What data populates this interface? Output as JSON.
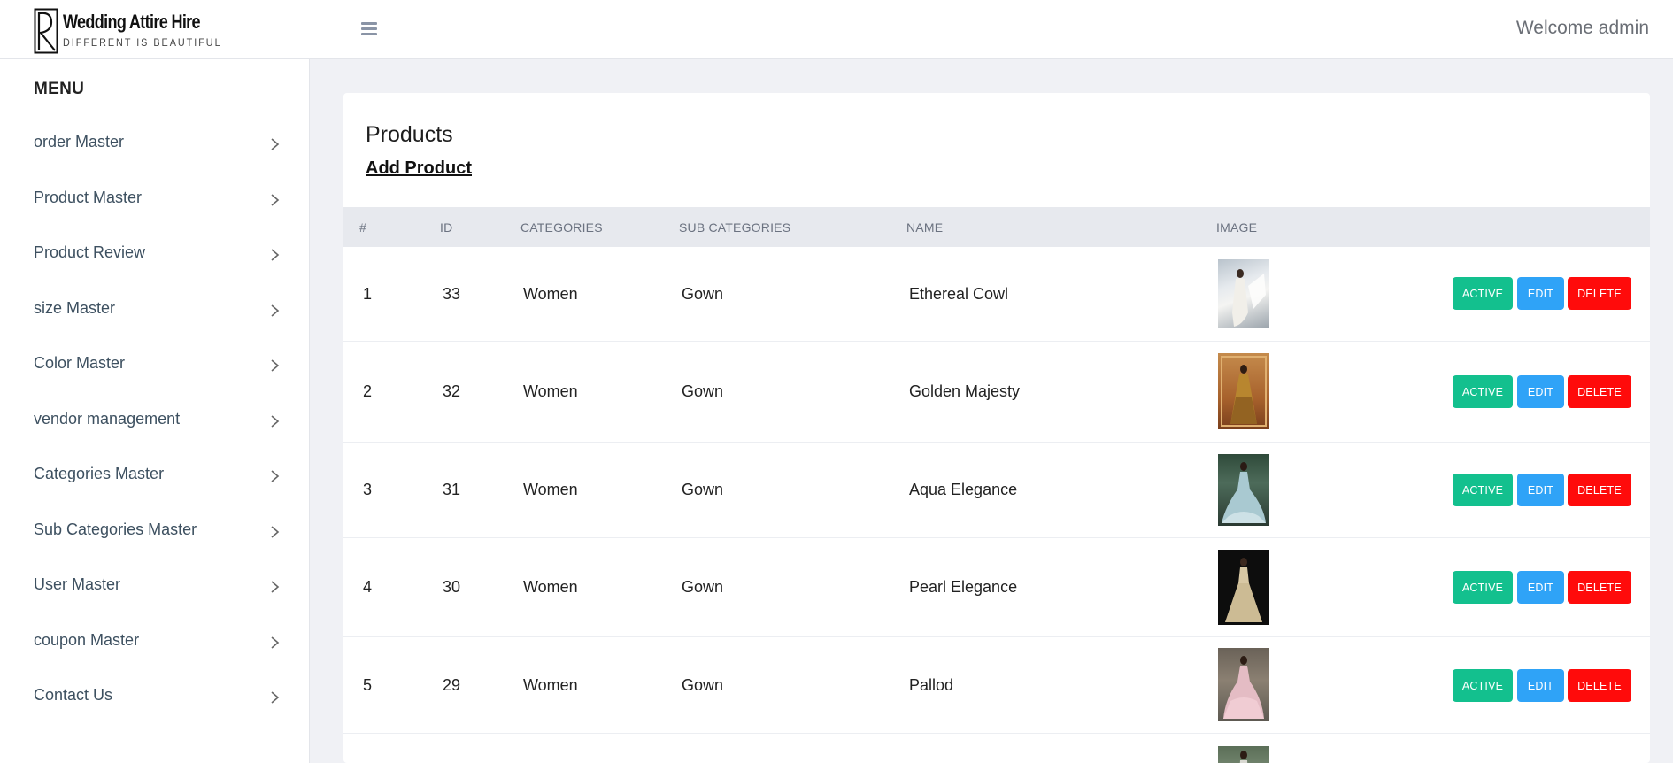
{
  "header": {
    "logo_title": "Wedding Attire Hire",
    "logo_tagline": "DIFFERENT IS BEAUTIFUL",
    "welcome": "Welcome admin"
  },
  "sidebar": {
    "heading": "MENU",
    "items": [
      {
        "label": "order Master"
      },
      {
        "label": "Product Master"
      },
      {
        "label": "Product Review"
      },
      {
        "label": "size Master"
      },
      {
        "label": "Color Master"
      },
      {
        "label": "vendor management"
      },
      {
        "label": "Categories Master"
      },
      {
        "label": "Sub Categories Master"
      },
      {
        "label": "User Master"
      },
      {
        "label": "coupon Master"
      },
      {
        "label": "Contact Us"
      }
    ]
  },
  "main": {
    "title": "Products",
    "add_label": "Add Product",
    "columns": [
      "#",
      "ID",
      "CATEGORIES",
      "SUB CATEGORIES",
      "NAME",
      "IMAGE"
    ],
    "rows": [
      {
        "num": "1",
        "id": "33",
        "category": "Women",
        "subcategory": "Gown",
        "name": "Ethereal Cowl",
        "active_label": "ACTIVE",
        "edit_label": "EDIT",
        "delete_label": "DELETE"
      },
      {
        "num": "2",
        "id": "32",
        "category": "Women",
        "subcategory": "Gown",
        "name": "Golden Majesty",
        "active_label": "ACTIVE",
        "edit_label": "EDIT",
        "delete_label": "DELETE"
      },
      {
        "num": "3",
        "id": "31",
        "category": "Women",
        "subcategory": "Gown",
        "name": "Aqua Elegance",
        "active_label": "ACTIVE",
        "edit_label": "EDIT",
        "delete_label": "DELETE"
      },
      {
        "num": "4",
        "id": "30",
        "category": "Women",
        "subcategory": "Gown",
        "name": "Pearl Elegance",
        "active_label": "ACTIVE",
        "edit_label": "EDIT",
        "delete_label": "DELETE"
      },
      {
        "num": "5",
        "id": "29",
        "category": "Women",
        "subcategory": "Gown",
        "name": "Pallod",
        "active_label": "ACTIVE",
        "edit_label": "EDIT",
        "delete_label": "DELETE"
      }
    ]
  },
  "colors": {
    "active": "#13c08e",
    "edit": "#2fa3f7",
    "delete": "#ff0b0b",
    "sidebar_text": "#3d5060"
  },
  "icons": [
    "menu-icon",
    "chevron-right-icon",
    "logo-mark-icon",
    "product-thumbnail"
  ]
}
